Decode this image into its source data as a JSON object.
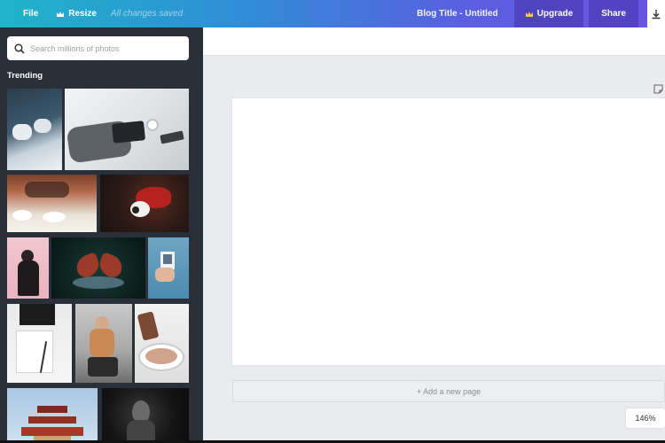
{
  "topbar": {
    "file_label": "File",
    "resize_label": "Resize",
    "saved_status": "All changes saved",
    "doc_title": "Blog Title - Untitled",
    "upgrade_label": "Upgrade",
    "share_label": "Share",
    "icons": [
      "crown-icon",
      "download-icon"
    ]
  },
  "panel": {
    "search_placeholder": "Search millions of photos",
    "section_title": "Trending",
    "photos": [
      "photo-feet-on-sheets",
      "photo-hands-on-tablet",
      "photo-cafe-table",
      "photo-red-parrot",
      "photo-woman-pink-wall",
      "photo-butterfly",
      "photo-polaroid-in-hand",
      "photo-notebook-desk",
      "photo-person-sitting",
      "photo-food-bowl",
      "photo-pagoda",
      "photo-dark-portrait"
    ]
  },
  "workspace": {
    "add_page_label": "+ Add a new page",
    "zoom_level": "146%"
  },
  "colors": {
    "panel_bg": "#293039",
    "workspace_bg": "#e9ebee",
    "topbar_start": "#1fb4c9",
    "topbar_end": "#6b53e2"
  }
}
